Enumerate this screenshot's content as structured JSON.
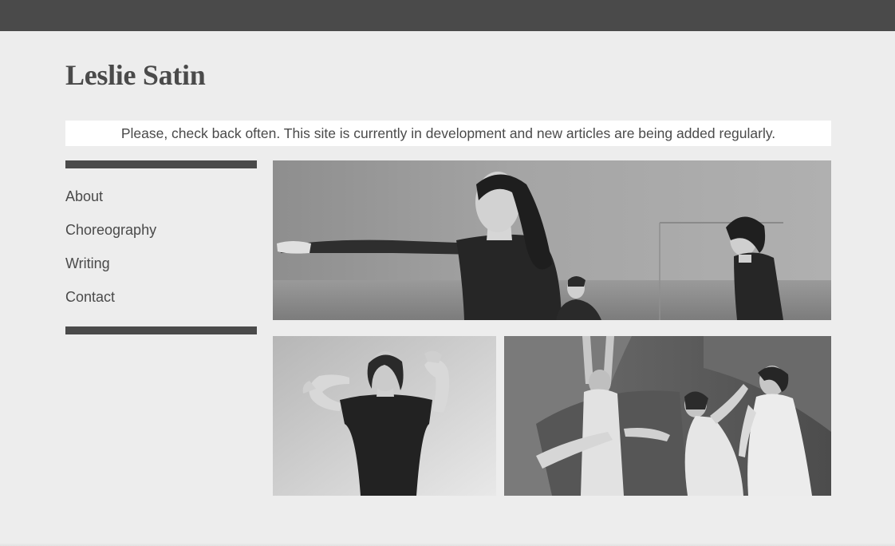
{
  "site": {
    "title": "Leslie Satin"
  },
  "notice": {
    "text": "Please, check back often. This site is currently in development and new articles are being added regularly."
  },
  "nav": {
    "items": [
      {
        "label": "About"
      },
      {
        "label": "Choreography"
      },
      {
        "label": "Writing"
      },
      {
        "label": "Contact"
      }
    ]
  },
  "colors": {
    "background": "#ededed",
    "topbar": "#4a4a4a",
    "text": "#4a4a4a",
    "notice_background": "#ffffff"
  }
}
